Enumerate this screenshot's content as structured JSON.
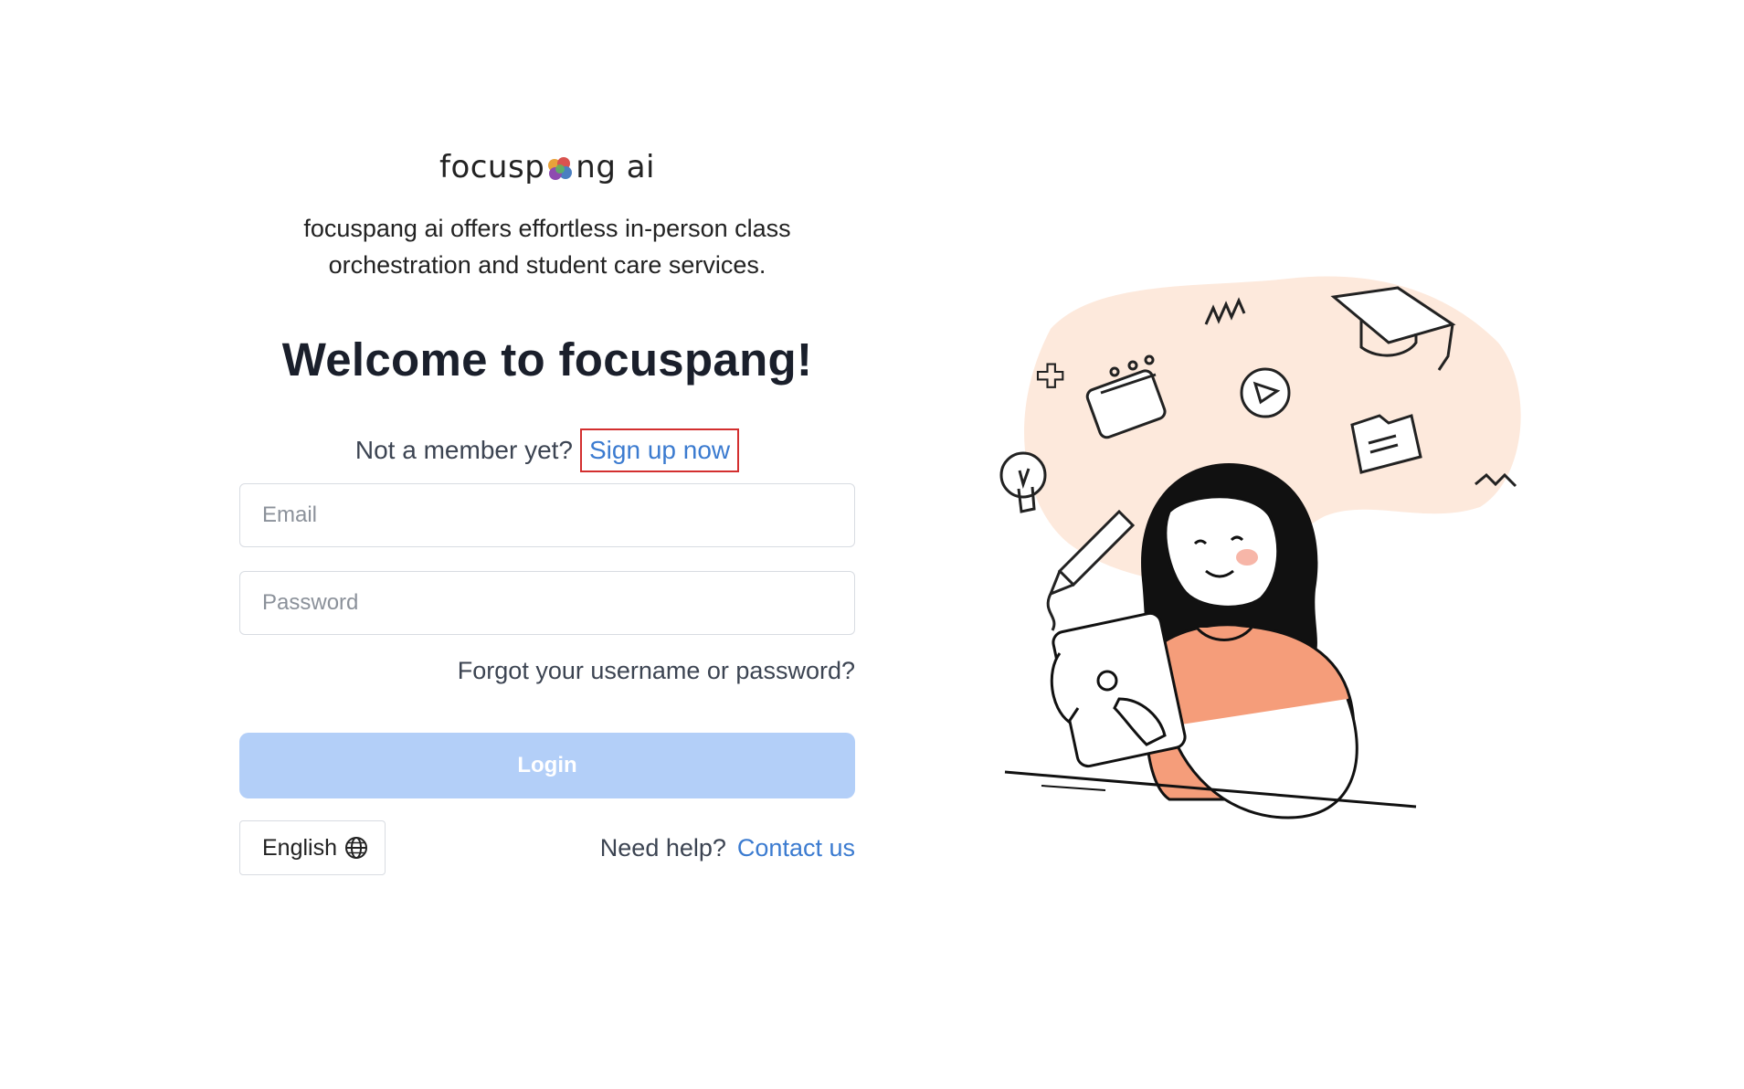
{
  "brand": {
    "logo_text_before": "focusp",
    "logo_text_after": "ng ai",
    "logo_icon": "brain-icon",
    "tagline_line1": "focuspang ai offers effortless in-person class",
    "tagline_line2": "orchestration and student care services."
  },
  "welcome": {
    "title": "Welcome to focuspang!"
  },
  "signup": {
    "prompt": "Not a member yet?",
    "link_label": "Sign up now"
  },
  "form": {
    "email_placeholder": "Email",
    "email_value": "",
    "password_placeholder": "Password",
    "password_value": "",
    "forgot_label": "Forgot your username or password?",
    "login_label": "Login"
  },
  "footer": {
    "language_label": "English",
    "language_icon": "globe-icon",
    "help_prompt": "Need help?",
    "contact_label": "Contact us"
  },
  "colors": {
    "link": "#3b7bd0",
    "login_button_bg": "#b3cff8",
    "highlight_border": "#d32f2f",
    "illustration_blob": "#fde9dc",
    "illustration_shirt": "#f59d7a"
  }
}
